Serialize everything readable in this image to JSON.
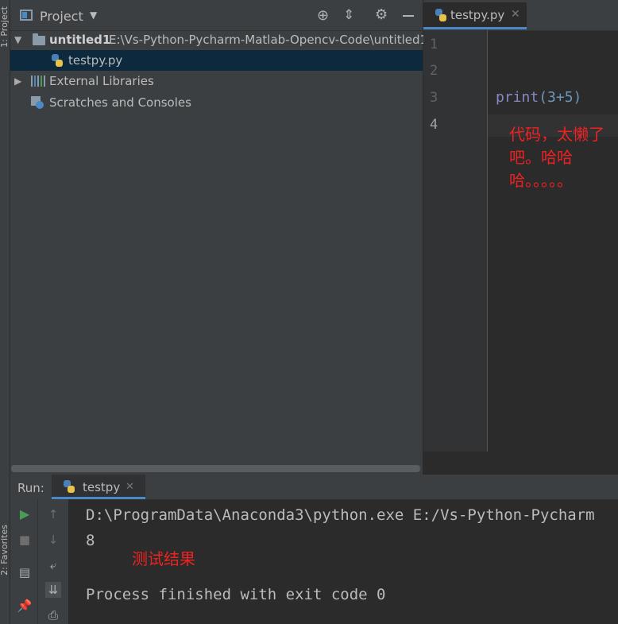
{
  "side_tabs": {
    "project": "1: Project",
    "favorites": "2: Favorites"
  },
  "project_panel": {
    "title": "Project",
    "tree": {
      "root_name": "untitled1",
      "root_path": "E:\\Vs-Python-Pycharm-Matlab-Opencv-Code\\untitled1",
      "file": "testpy.py",
      "external_libraries": "External Libraries",
      "scratches": "Scratches and Consoles"
    }
  },
  "editor": {
    "tab_label": "testpy.py",
    "line_numbers": [
      "1",
      "2",
      "3",
      "4"
    ],
    "code_func": "print",
    "code_args": "(3+5)",
    "annotation_lines": [
      "代码，太懒了",
      "吧。哈哈",
      "哈。。。。。"
    ]
  },
  "run_panel": {
    "label": "Run:",
    "tab_label": "testpy",
    "console": {
      "command": "D:\\ProgramData\\Anaconda3\\python.exe E:/Vs-Python-Pycharm",
      "output": "8",
      "annotation": "测试结果",
      "exit": "Process finished with exit code 0"
    }
  },
  "colors": {
    "accent": "#4a88c7",
    "annotation_red": "#ee2222",
    "code_func": "#8888c6",
    "run_green": "#499c54"
  }
}
